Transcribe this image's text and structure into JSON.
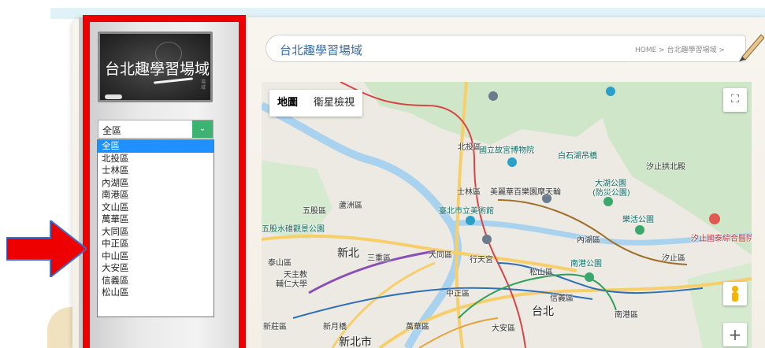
{
  "sidebar": {
    "logo_text": "台北趣學習場域",
    "logo_side_text": "場域",
    "district_select": {
      "value": "全區",
      "options": [
        "全區",
        "北投區",
        "士林區",
        "內湖區",
        "南港區",
        "文山區",
        "萬華區",
        "大同區",
        "中正區",
        "中山區",
        "大安區",
        "信義區",
        "松山區"
      ]
    }
  },
  "header": {
    "title": "台北趣學習場域",
    "breadcrumb": "HOME > 台北趣學習場域 >"
  },
  "map": {
    "map_type_map": "地圖",
    "map_type_satellite": "衛星檢視",
    "fullscreen_glyph": "⛶",
    "zoom_in_glyph": "+",
    "labels": {
      "beitou": "北投區",
      "palace_museum": "國立故宮博物院",
      "baishi_lake": "白石湖吊橋",
      "xizhi_temple": "汐止拱北殿",
      "dahu_park": "大湖公園",
      "dahu_park2": "(防災公園)",
      "shilin": "士林區",
      "miramar": "美麗華百樂園摩天輪",
      "luzhou": "蘆洲區",
      "fine_arts": "臺北市立美術館",
      "wugu": "五股區",
      "wugu_park": "五股水碓觀景公園",
      "neihu": "內湖區",
      "lehuo": "樂活公園",
      "xizhi_hospital": "汐止國泰綜合醫院",
      "taishan": "泰山區",
      "xinbei": "新北",
      "sanchong": "三重區",
      "datong": "大同區",
      "xingtian": "行天宮",
      "nangang_park": "南港公園",
      "xizhi": "汐止區",
      "fu_jen": "天主教",
      "fu_jen2": "輔仁大學",
      "songshan": "松山區",
      "zhongzheng": "中正區",
      "xinyi": "信義區",
      "taipei": "台北",
      "nangang": "南港區",
      "xinzhuang": "新莊區",
      "xinyue": "新月橋",
      "wanhua": "萬華區",
      "daan": "大安區",
      "newtaipei_city": "新北市"
    }
  }
}
